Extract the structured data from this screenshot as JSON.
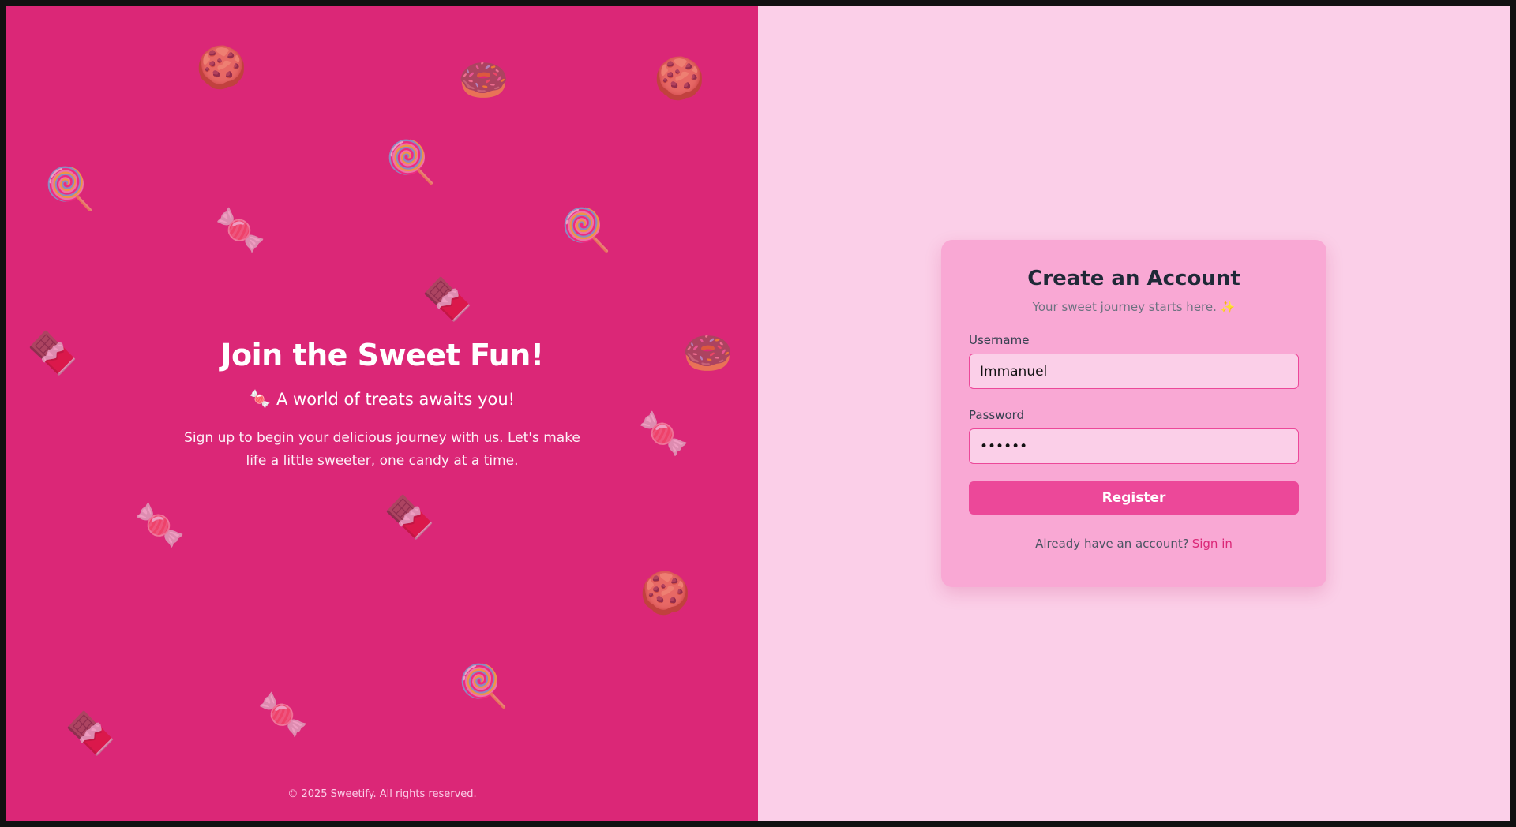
{
  "left_panel": {
    "background_color": "#db2777",
    "title": "Join the Sweet Fun!",
    "tagline_icon": "🍬",
    "tagline": "A world of treats awaits you!",
    "description": "Sign up to begin your delicious journey with us. Let's make life a little sweeter, one candy at a time.",
    "footer": "© 2025 Sweetify. All rights reserved.",
    "decorations": [
      {
        "icon": "cookie-icon",
        "glyph": "🍪"
      },
      {
        "icon": "donut-icon",
        "glyph": "🍩"
      },
      {
        "icon": "cookie-icon",
        "glyph": "🍪"
      },
      {
        "icon": "lollipop-icon",
        "glyph": "🍭"
      },
      {
        "icon": "lollipop-icon",
        "glyph": "🍭"
      },
      {
        "icon": "candy-icon",
        "glyph": "🍬"
      },
      {
        "icon": "lollipop-icon",
        "glyph": "🍭"
      },
      {
        "icon": "chocolate-bar-icon",
        "glyph": "🍫"
      },
      {
        "icon": "chocolate-bar-icon",
        "glyph": "🍫"
      },
      {
        "icon": "donut-icon",
        "glyph": "🍩"
      },
      {
        "icon": "candy-icon",
        "glyph": "🍬"
      },
      {
        "icon": "candy-icon",
        "glyph": "🍬"
      },
      {
        "icon": "chocolate-bar-icon",
        "glyph": "🍫"
      },
      {
        "icon": "cookie-icon",
        "glyph": "🍪"
      },
      {
        "icon": "lollipop-icon",
        "glyph": "🍭"
      },
      {
        "icon": "chocolate-bar-icon",
        "glyph": "🍫"
      },
      {
        "icon": "candy-icon",
        "glyph": "🍬"
      }
    ]
  },
  "register_card": {
    "title": "Create an Account",
    "subtitle": "Your sweet journey starts here. ✨",
    "username_label": "Username",
    "username_value": "Immanuel",
    "password_label": "Password",
    "password_value": "••••••",
    "register_label": "Register",
    "signin_prompt": "Already have an account?",
    "signin_link": "Sign in"
  },
  "colors": {
    "accent": "#ec4899",
    "brand": "#db2777",
    "right_background": "#fbcfe8",
    "card_background": "#f9a8d4"
  }
}
